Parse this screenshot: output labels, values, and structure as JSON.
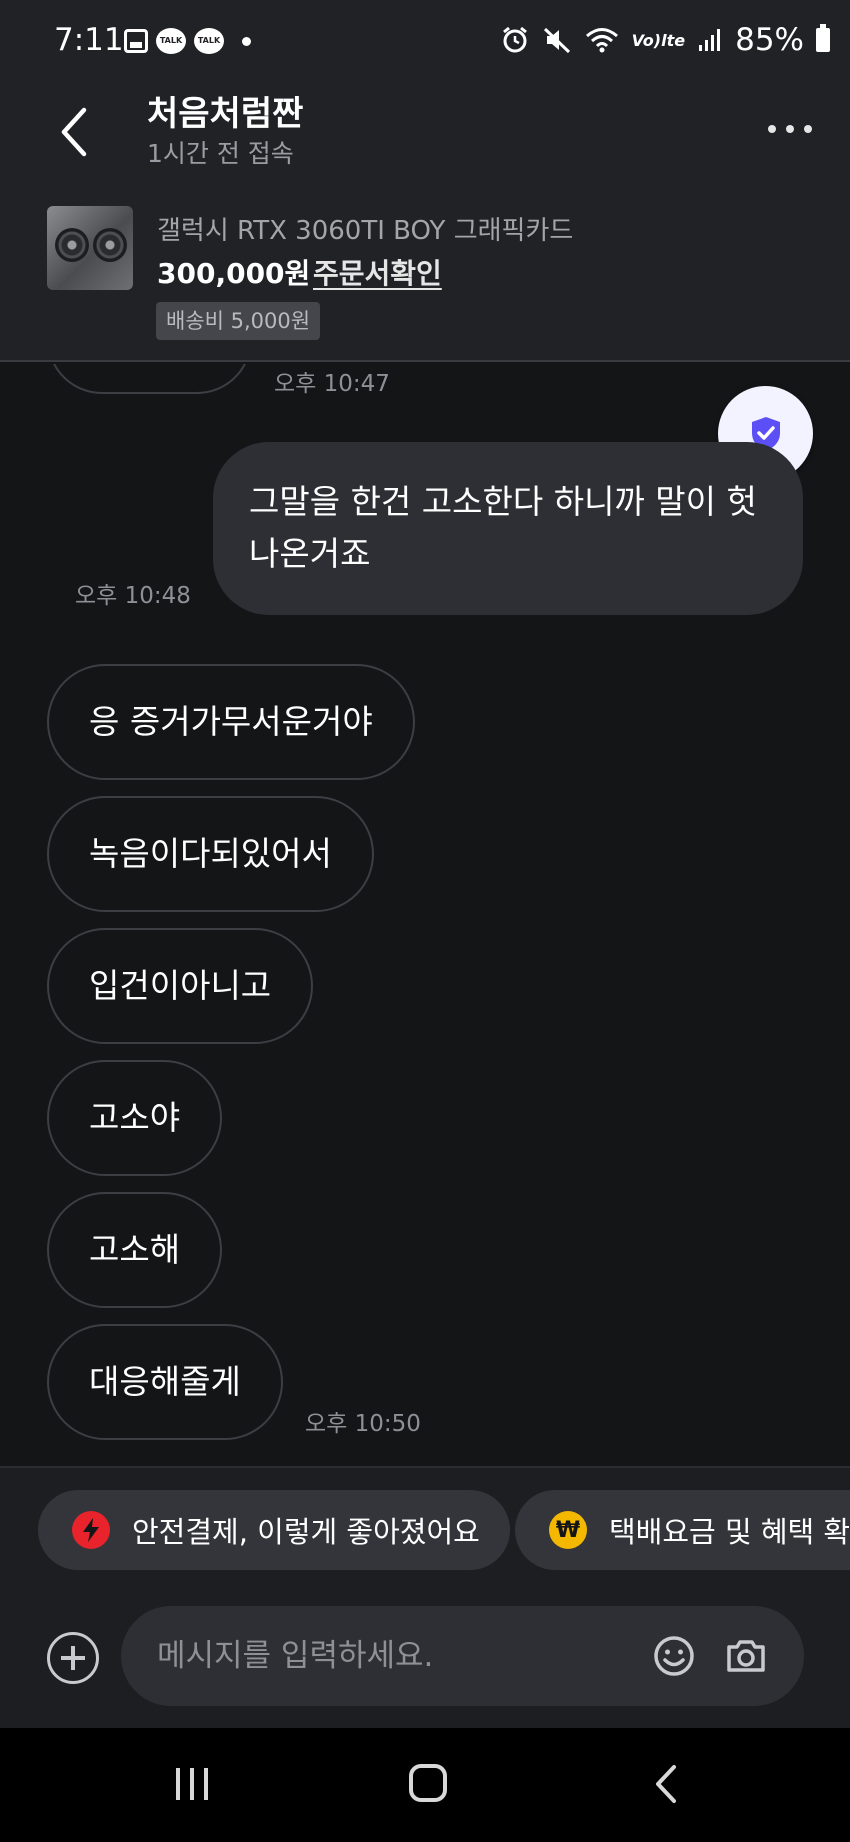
{
  "status_bar": {
    "time": "7:11",
    "talk_badge": "TALK",
    "battery": "85%",
    "lte": "Vo)lte"
  },
  "header": {
    "title": "처음처럼짠",
    "subtitle": "1시간 전 접속"
  },
  "product": {
    "name": "갤럭시 RTX 3060TI BOY 그래픽카드",
    "price": "300,000원",
    "order_link": "주문서확인",
    "shipping": "배송비 5,000원"
  },
  "messages": {
    "ts_top": "오후 10:47",
    "outgoing_text": "그말을 한건 고소한다 하니까 말이 헛나온거죠",
    "ts_outgoing": "오후 10:48",
    "incoming": [
      "응 증거가무서운거야",
      "녹음이다되있어서",
      "입건이아니고",
      "고소야",
      "고소해",
      "대응해줄게"
    ],
    "ts_last": "오후 10:50"
  },
  "chips": [
    {
      "label": "안전결제, 이렇게 좋아졌어요",
      "icon": "lightning-icon",
      "color": "#e8232b"
    },
    {
      "label": "택배요금 및 혜택 확인",
      "icon": "won-icon",
      "color": "#f5b800",
      "glyph": "₩"
    }
  ],
  "composer": {
    "placeholder": "메시지를 입력하세요."
  },
  "colors": {
    "background": "#141517",
    "header": "#212226",
    "shield": "#5b4ff5"
  }
}
